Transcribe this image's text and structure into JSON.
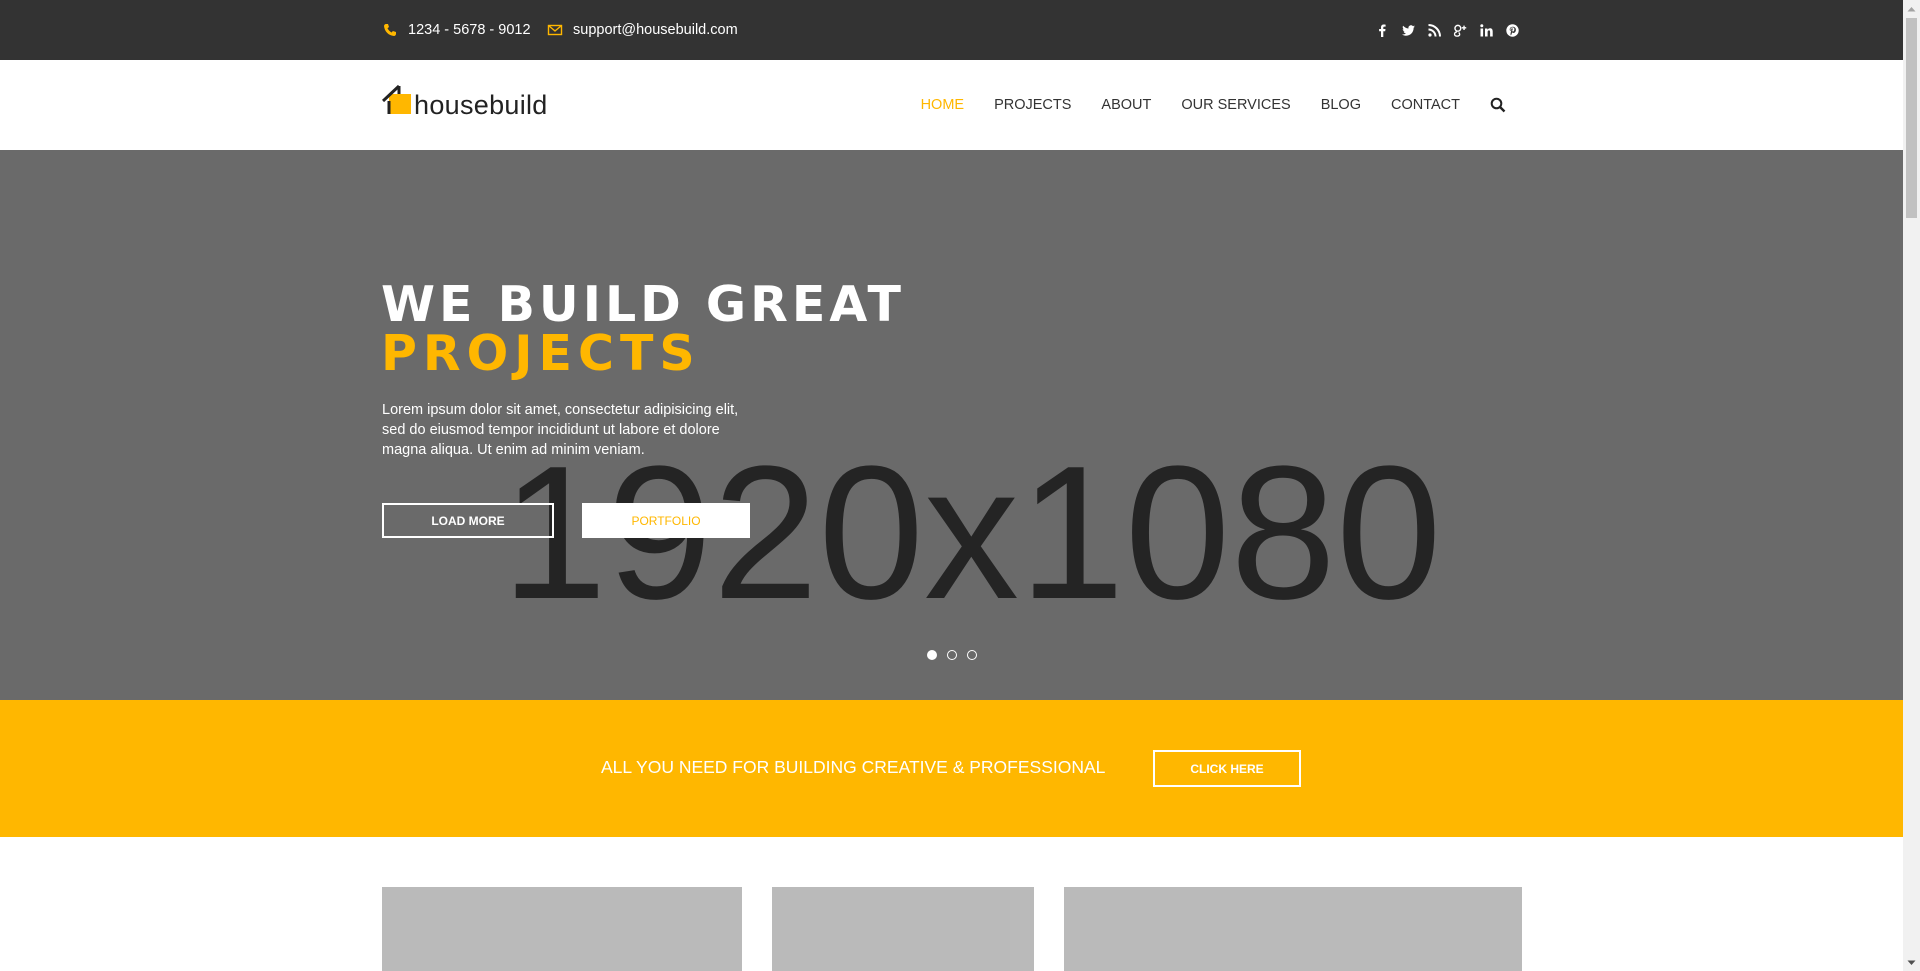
{
  "topbar": {
    "phone": "1234 - 5678 - 9012",
    "email": "support@housebuild.com",
    "social_icons": [
      "facebook-icon",
      "twitter-icon",
      "rss-icon",
      "google-plus-icon",
      "linkedin-icon",
      "pinterest-icon"
    ]
  },
  "header": {
    "logo_text": "housebuild",
    "nav": [
      {
        "label": "HOME",
        "active": true
      },
      {
        "label": "PROJECTS",
        "active": false
      },
      {
        "label": "ABOUT",
        "active": false
      },
      {
        "label": "OUR SERVICES",
        "active": false
      },
      {
        "label": "BLOG",
        "active": false
      },
      {
        "label": "CONTACT",
        "active": false
      }
    ]
  },
  "hero": {
    "placeholder": "1920x1080",
    "title_line1": "WE BUILD GREAT",
    "title_line2": "PROJECTS",
    "text": "Lorem ipsum dolor sit amet, consectetur adipisicing elit, sed do eiusmod tempor incididunt ut labore et dolore magna aliqua. Ut enim ad minim veniam.",
    "btn_load_more": "LOAD MORE",
    "btn_portfolio": "PORTFOLIO",
    "slides": 3,
    "active_slide": 1
  },
  "band": {
    "text": "ALL YOU NEED FOR BUILDING CREATIVE & PROFESSIONAL",
    "button": "CLICK HERE"
  },
  "colors": {
    "accent": "#ffb700",
    "topbar_bg": "#333333",
    "hero_bg": "#6a6a6a",
    "card_bg": "#bababa"
  }
}
